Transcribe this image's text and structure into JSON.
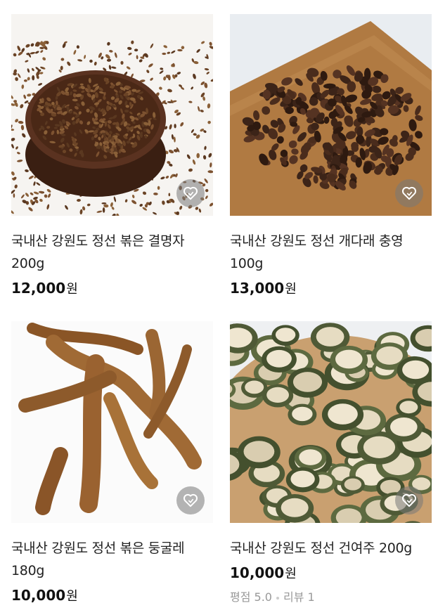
{
  "products": [
    {
      "image_alt": "볶은 결명자",
      "name": "국내산 강원도 정선 볶은 결명자 200g",
      "price": "12,000",
      "currency": "원",
      "wishlist_icon": "heart-icon"
    },
    {
      "image_alt": "개다래 충영",
      "name": "국내산 강원도 정선 개다래 충영 100g",
      "price": "13,000",
      "currency": "원",
      "wishlist_icon": "heart-icon"
    },
    {
      "image_alt": "볶은 둥굴레",
      "name": "국내산 강원도 정선 볶은 둥굴레 180g",
      "price": "10,000",
      "currency": "원",
      "wishlist_icon": "heart-icon"
    },
    {
      "image_alt": "건여주",
      "name": "국내산 강원도 정선 건여주 200g",
      "price": "10,000",
      "currency": "원",
      "rating_label": "평점 5.0",
      "review_label": "리뷰 1",
      "wishlist_icon": "heart-icon"
    }
  ],
  "colors": {
    "wishlist_bg": "#808080",
    "text": "#222222",
    "muted": "#999999"
  }
}
